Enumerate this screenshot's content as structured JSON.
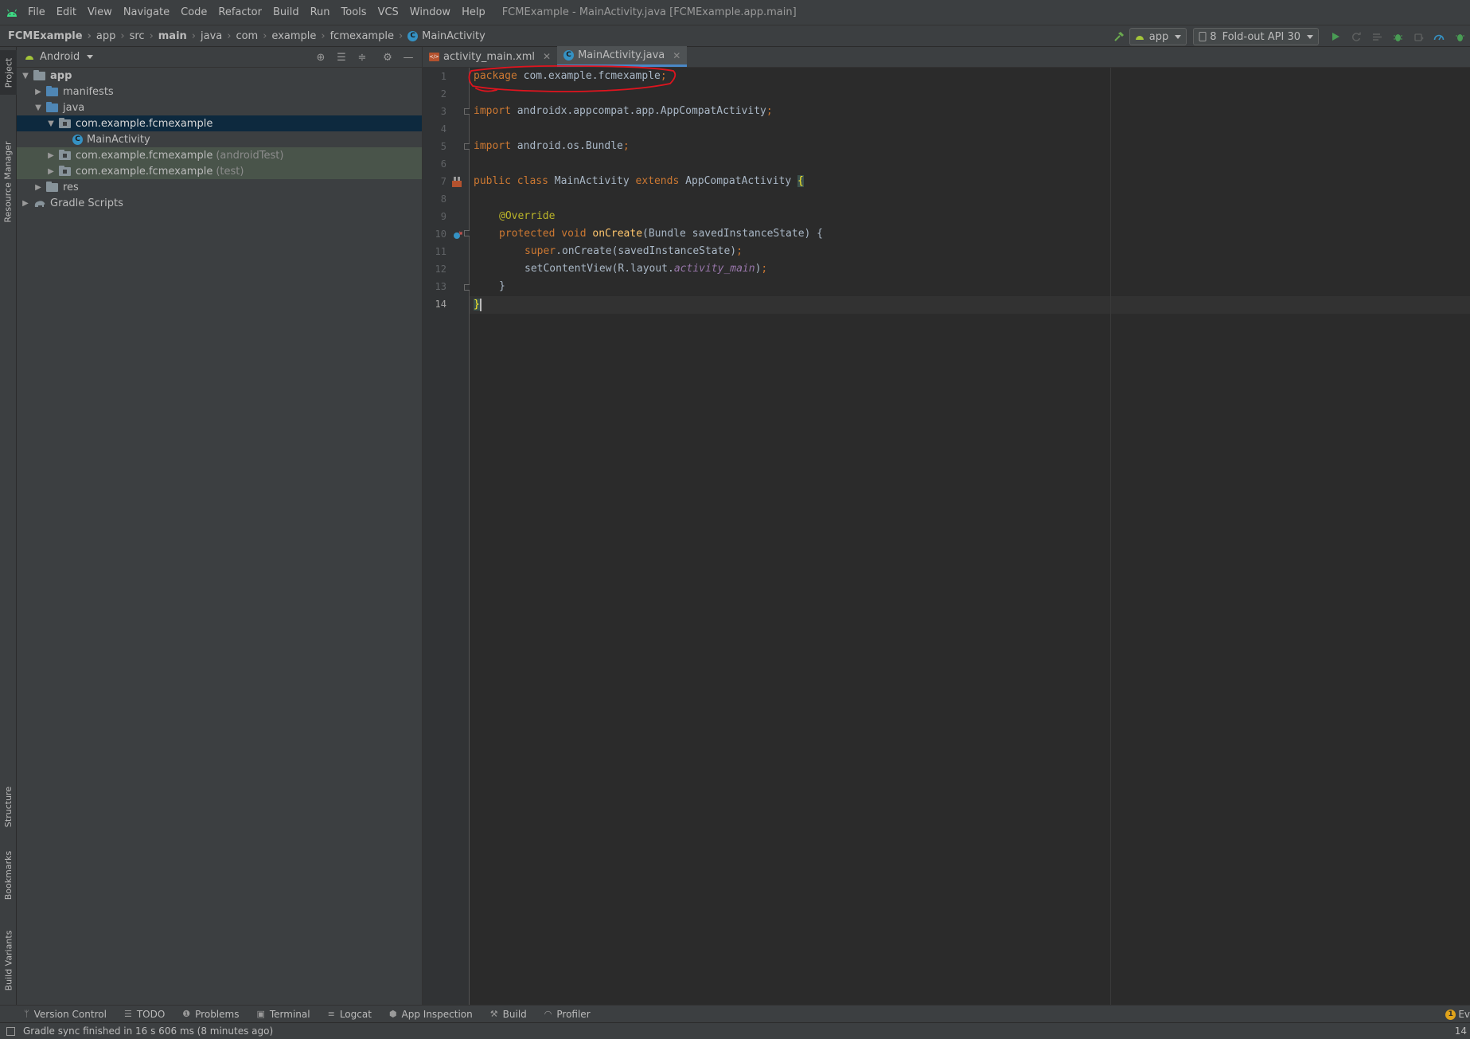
{
  "menubar": {
    "logo_icon": "android-studio-icon",
    "items": [
      "File",
      "Edit",
      "View",
      "Navigate",
      "Code",
      "Refactor",
      "Build",
      "Run",
      "Tools",
      "VCS",
      "Window",
      "Help"
    ],
    "window_title": "FCMExample - MainActivity.java [FCMExample.app.main]"
  },
  "breadcrumb": [
    "FCMExample",
    "app",
    "src",
    "main",
    "java",
    "com",
    "example",
    "fcmexample",
    "MainActivity"
  ],
  "toolbar": {
    "run_config": "app",
    "device_prefix": "8",
    "device": "Fold-out API 30"
  },
  "left_strip": {
    "tabs": [
      "Project",
      "Resource Manager",
      "Structure",
      "Bookmarks",
      "Build Variants"
    ]
  },
  "project_panel": {
    "view_mode": "Android",
    "tree": [
      {
        "label": "app",
        "suffix": ""
      },
      {
        "label": "manifests",
        "suffix": ""
      },
      {
        "label": "java",
        "suffix": ""
      },
      {
        "label": "com.example.fcmexample",
        "suffix": ""
      },
      {
        "label": "MainActivity",
        "suffix": ""
      },
      {
        "label": "com.example.fcmexample",
        "suffix": "(androidTest)"
      },
      {
        "label": "com.example.fcmexample",
        "suffix": "(test)"
      },
      {
        "label": "res",
        "suffix": ""
      },
      {
        "label": "Gradle Scripts",
        "suffix": ""
      }
    ]
  },
  "editor": {
    "tabs": [
      {
        "label": "activity_main.xml",
        "active": false
      },
      {
        "label": "MainActivity.java",
        "active": true
      }
    ],
    "line_numbers": [
      "1",
      "2",
      "3",
      "4",
      "5",
      "6",
      "7",
      "8",
      "9",
      "10",
      "11",
      "12",
      "13",
      "14"
    ],
    "current_line": 14,
    "code": {
      "l1_kw": "package",
      "l1_rest": " com.example.fcmexample",
      "l1_semi": ";",
      "l3_kw": "import",
      "l3_rest": " androidx.appcompat.app.AppCompatActivity",
      "l3_semi": ";",
      "l5_kw": "import",
      "l5_rest": " android.os.Bundle",
      "l5_semi": ";",
      "l7_kw1": "public class",
      "l7_name": " MainActivity ",
      "l7_kw2": "extends",
      "l7_super": " AppCompatActivity ",
      "l7_brace": "{",
      "l9_ann": "@Override",
      "l10_kw": "protected void",
      "l10_fn": "onCreate",
      "l10_rest": "(Bundle savedInstanceState) {",
      "l11_kw": "super",
      "l11_rest": ".onCreate(savedInstanceState)",
      "l11_semi": ";",
      "l12_pre": "setContentView(R.layout.",
      "l12_field": "activity_main",
      "l12_post": ")",
      "l12_semi": ";",
      "l13": "}",
      "l14": "}"
    },
    "annotation_color": "#e0141e"
  },
  "bottom_tools": [
    "Version Control",
    "TODO",
    "Problems",
    "Terminal",
    "Logcat",
    "App Inspection",
    "Build",
    "Profiler"
  ],
  "event_log": {
    "badge": "1",
    "label": "Ev"
  },
  "statusbar": {
    "message": "Gradle sync finished in 16 s 606 ms (8 minutes ago)",
    "position": "14"
  },
  "colors": {
    "keyword": "#cc7832",
    "annotation": "#bbb529",
    "method": "#ffc66d",
    "field": "#9876aa",
    "selection": "#0d293e",
    "test_folder_bg": "#49544a"
  }
}
